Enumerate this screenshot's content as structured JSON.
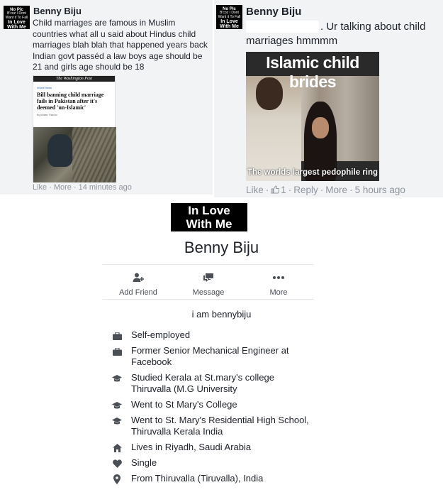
{
  "comment_left": {
    "avatar": {
      "line1": "No Pic",
      "line2": "B'coz I Dont",
      "line3": "Want it To Fall",
      "line4": "In Love",
      "line5": "With Me"
    },
    "author": "Benny Biju",
    "text": "Child marriages are famous in Muslim countries what all u said about Hindus child marriages blah blah that happened years back Indian govt passéd a law boys age should be 21 and girls age should be 18",
    "article": {
      "masthead": "The Washington Post",
      "section": "WorldViews",
      "headline": "Bill banning child marriage fails in Pakistan after it's deemed 'un-Islamic'",
      "byline": "By Ishaan Tharoor"
    },
    "actions": {
      "like": "Like",
      "more": "More",
      "time": "14 minutes ago"
    }
  },
  "comment_right": {
    "avatar": {
      "line1": "No Pic",
      "line2": "B'coz I Dont",
      "line3": "Want it To Fall",
      "line4": "In Love",
      "line5": "With Me"
    },
    "author": "Benny Biju",
    "text_line1": ". Ur talking about child",
    "text_line2": "marriages hmmmm",
    "image": {
      "top_caption": "Islamic child brides",
      "bottom_caption": "The worlds largest pedophile ring"
    },
    "actions": {
      "like": "Like",
      "like_count": "1",
      "reply": "Reply",
      "more": "More",
      "time": "5 hours ago"
    }
  },
  "profile": {
    "cover_line1": "In Love",
    "cover_line2": "With Me",
    "name": "Benny Biju",
    "actions": [
      {
        "label": "Add Friend",
        "icon": "add-friend-icon"
      },
      {
        "label": "Message",
        "icon": "message-icon"
      },
      {
        "label": "More",
        "icon": "more-dots-icon"
      }
    ],
    "tagline": "i am bennybiju",
    "info": [
      {
        "icon": "briefcase-icon",
        "text": "Self-employed"
      },
      {
        "icon": "briefcase-icon",
        "text": "Former Senior Mechanical Engineer at Facebook"
      },
      {
        "icon": "graduation-cap-icon",
        "text": "Studied Kerala at St.mary's college Thiruvalla (M.G University"
      },
      {
        "icon": "graduation-cap-icon",
        "text": "Went to St Mary's College"
      },
      {
        "icon": "graduation-cap-icon",
        "text": "Went to St. Mary's Residential High School, Thiruvalla Kerala India"
      },
      {
        "icon": "home-icon",
        "text": "Lives in Riyadh, Saudi Arabia"
      },
      {
        "icon": "heart-icon",
        "text": "Single"
      },
      {
        "icon": "location-pin-icon",
        "text": "From Thiruvalla (Tiruvalla), India"
      }
    ]
  },
  "colors": {
    "panel_bg": "#f2f3f5",
    "meta_gray": "#90949c",
    "icon_gray": "#4b4f56"
  }
}
